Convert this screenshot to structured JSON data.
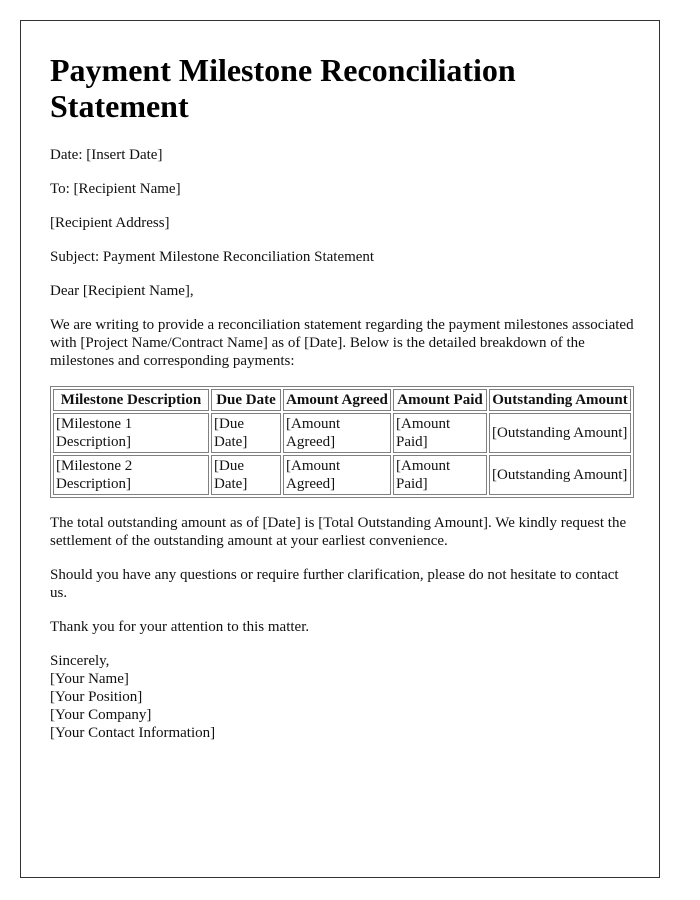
{
  "document": {
    "title": "Payment Milestone Reconciliation Statement",
    "date_line": "Date: [Insert Date]",
    "to_line": "To: [Recipient Name]",
    "address_line": "[Recipient Address]",
    "subject_line": "Subject: Payment Milestone Reconciliation Statement",
    "salutation": "Dear [Recipient Name],",
    "intro_paragraph": "We are writing to provide a reconciliation statement regarding the payment milestones associated with [Project Name/Contract Name] as of [Date]. Below is the detailed breakdown of the milestones and corresponding payments:",
    "table": {
      "headers": [
        "Milestone Description",
        "Due Date",
        "Amount Agreed",
        "Amount Paid",
        "Outstanding Amount"
      ],
      "rows": [
        [
          "[Milestone 1 Description]",
          "[Due Date]",
          "[Amount Agreed]",
          "[Amount Paid]",
          "[Outstanding Amount]"
        ],
        [
          "[Milestone 2 Description]",
          "[Due Date]",
          "[Amount Agreed]",
          "[Amount Paid]",
          "[Outstanding Amount]"
        ]
      ]
    },
    "total_paragraph": "The total outstanding amount as of [Date] is [Total Outstanding Amount]. We kindly request the settlement of the outstanding amount at your earliest convenience.",
    "questions_paragraph": "Should you have any questions or require further clarification, please do not hesitate to contact us.",
    "thanks_paragraph": "Thank you for your attention to this matter.",
    "signature": {
      "closing": "Sincerely,",
      "name": "[Your Name]",
      "position": "[Your Position]",
      "company": "[Your Company]",
      "contact": "[Your Contact Information]"
    }
  }
}
